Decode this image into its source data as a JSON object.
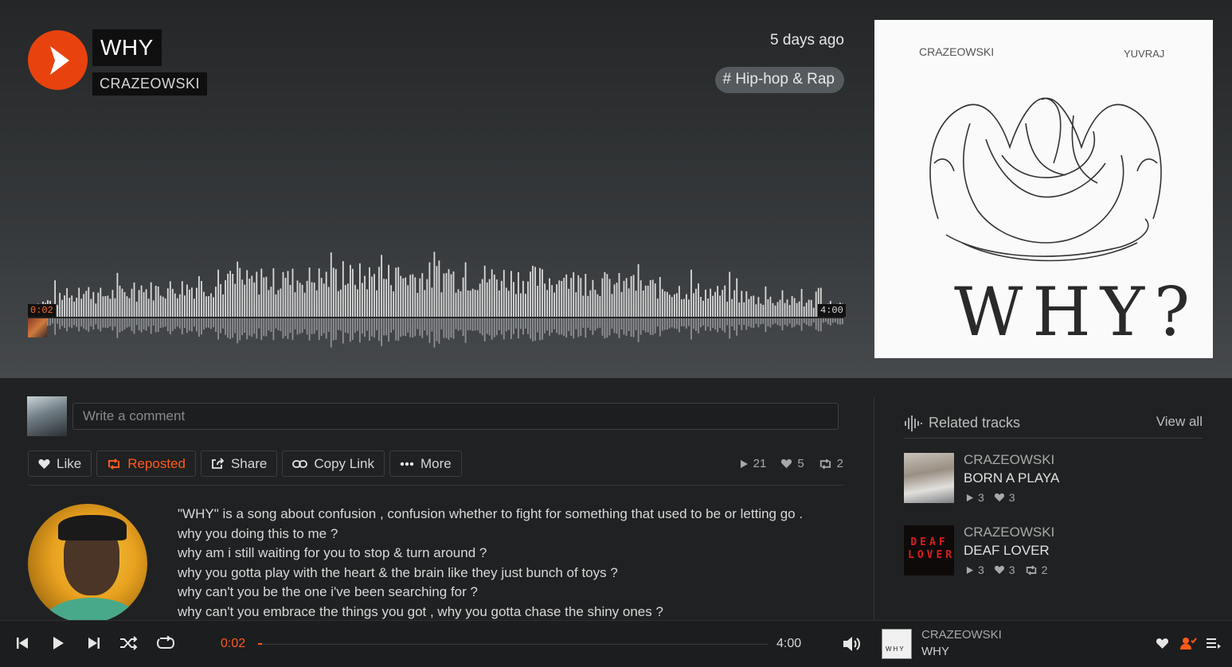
{
  "track": {
    "title": "WHY",
    "artist": "CRAZEOWSKI",
    "posted": "5 days ago",
    "tag": "# Hip-hop & Rap",
    "time_current": "0:02",
    "time_total": "4:00",
    "progress_fraction": 0.008
  },
  "cover": {
    "artist": "CRAZEOWSKI",
    "featuring": "YUVRAJ",
    "title": "WHY?"
  },
  "comment": {
    "placeholder": "Write a comment"
  },
  "actions": {
    "like": "Like",
    "repost": "Reposted",
    "share": "Share",
    "copy_link": "Copy Link",
    "more": "More"
  },
  "stats": {
    "plays": "21",
    "likes": "5",
    "reposts": "2"
  },
  "description": [
    "\"WHY\" is a song about confusion , confusion whether to fight for something that used to be or letting go .",
    "why you doing this to me ?",
    "why am i still waiting for you to stop & turn around ?",
    "why you gotta play with the heart & the brain like they just bunch of toys ?",
    "why can't you be the one i've been searching for ?",
    "why can't you embrace the things you got , why you gotta chase the shiny ones ?"
  ],
  "related": {
    "title": "Related tracks",
    "view_all": "View all",
    "items": [
      {
        "artist": "CRAZEOWSKI",
        "track": "BORN A PLAYA",
        "plays": "3",
        "likes": "3",
        "reposts": ""
      },
      {
        "artist": "CRAZEOWSKI",
        "track": "DEAF LOVER",
        "plays": "3",
        "likes": "3",
        "reposts": "2",
        "thumb_text": "DEAF LOVER"
      }
    ]
  },
  "player": {
    "artist": "CRAZEOWSKI",
    "track": "WHY",
    "time_current": "0:02",
    "time_total": "4:00",
    "thumb_text": "WHY"
  },
  "colors": {
    "accent": "#ff5a1a",
    "play_button": "#e8430f"
  }
}
